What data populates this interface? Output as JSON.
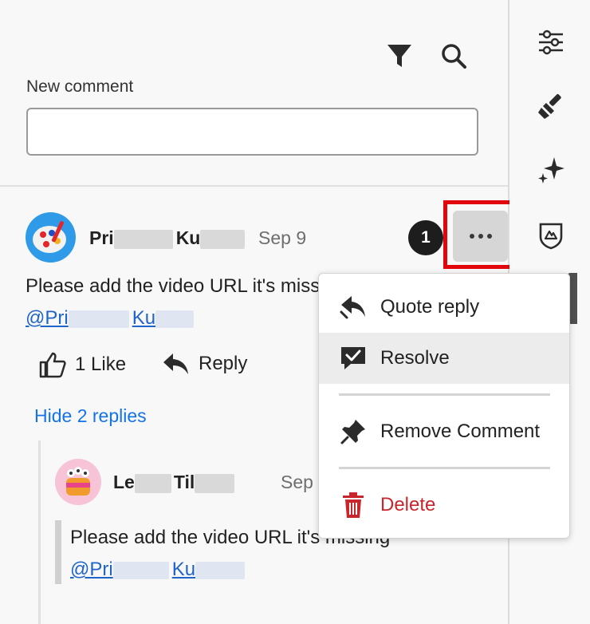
{
  "toolbar": {
    "filter_icon": "filter-icon",
    "search_icon": "search-icon"
  },
  "new_comment": {
    "label": "New comment",
    "value": "",
    "placeholder": ""
  },
  "comment": {
    "author_visible_1": "Pri",
    "author_visible_2": "Ku",
    "date": "Sep 9",
    "body": "Please add the video URL it's missi",
    "mention_visible_1": "@Pri",
    "mention_visible_2": "Ku",
    "like_label": "1 Like",
    "reply_label": "Reply",
    "notification_count": "1",
    "hide_replies_label": "Hide 2 replies"
  },
  "reply": {
    "author_visible_1": "Le",
    "author_visible_2": "Til",
    "date": "Sep",
    "body": "Please add the video URL it's missing",
    "mention_visible_1": "@Pri",
    "mention_visible_2": "Ku"
  },
  "menu": {
    "items": [
      {
        "label": "Quote reply",
        "icon": "quote-reply-icon"
      },
      {
        "label": "Resolve",
        "icon": "resolve-icon"
      },
      {
        "label": "Remove Comment",
        "icon": "pin-icon"
      },
      {
        "label": "Delete",
        "icon": "trash-icon"
      }
    ]
  },
  "rail": {
    "icons": [
      "sliders-icon",
      "brush-icon",
      "sparkle-icon",
      "badge-icon"
    ]
  },
  "colors": {
    "accent_link": "#1473e6",
    "danger": "#c9252d",
    "highlight": "#e1060b"
  }
}
